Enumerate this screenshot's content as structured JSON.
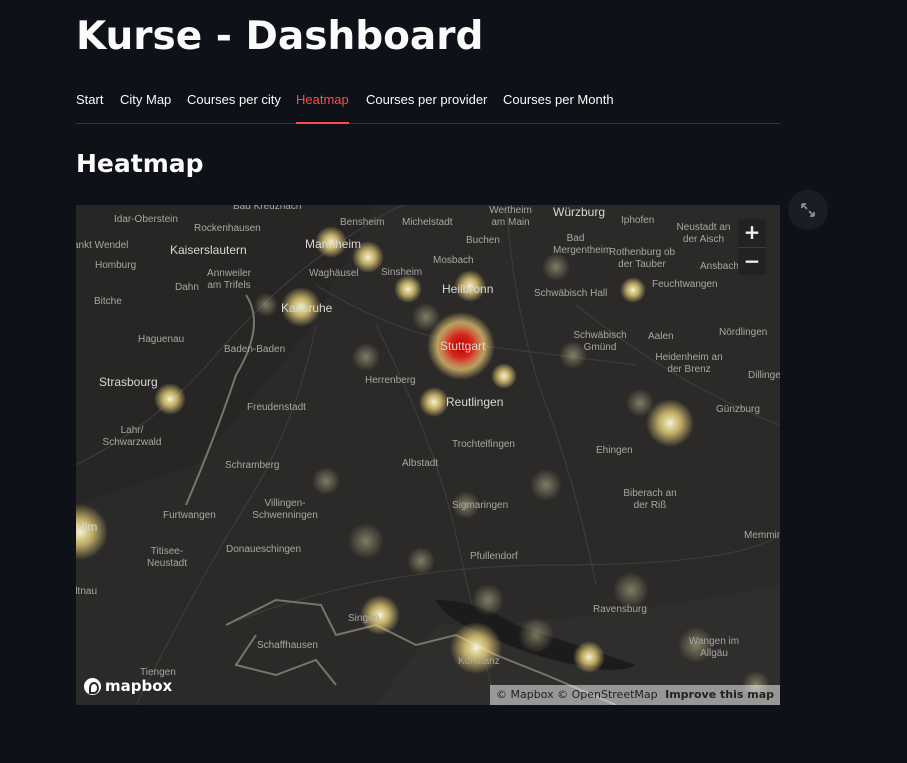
{
  "page": {
    "title": "Kurse - Dashboard"
  },
  "tabs": [
    {
      "label": "Start"
    },
    {
      "label": "City Map"
    },
    {
      "label": "Courses per city"
    },
    {
      "label": "Heatmap",
      "active": true
    },
    {
      "label": "Courses per provider"
    },
    {
      "label": "Courses per Month"
    }
  ],
  "section": {
    "title": "Heatmap"
  },
  "map": {
    "zoom_in": "+",
    "zoom_out": "−",
    "logo": "mapbox",
    "attribution": "© Mapbox © OpenStreetMap",
    "improve": "Improve this map",
    "labels": [
      "Bad Kreuznach",
      "Idar-Oberstein",
      "Rockenhausen",
      "Bensheim",
      "Michelstadt",
      "Wertheim am Main",
      "Würzburg",
      "Iphofen",
      "Neustadt an der Aisch",
      "ankt Wendel",
      "Kaiserslautern",
      "Buchen",
      "Bad Mergentheim",
      "Rothenburg ob der Tauber",
      "Homburg",
      "Annweiler am Trifels",
      "Dahn",
      "Waghäusel",
      "Sinsheim",
      "Mosbach",
      "Ansbach",
      "Feuchtwangen",
      "Heilbronn",
      "Schwäbisch Hall",
      "Bitche",
      "Karlsruhe",
      "Mannheim",
      "Haguenau",
      "Baden-Baden",
      "Schwäbisch Gmünd",
      "Aalen",
      "Nördlingen",
      "Heidenheim an der Brenz",
      "Stuttgart",
      "Strasbourg",
      "Herrenberg",
      "Dillingen",
      "Freudenstadt",
      "Reutlingen",
      "Günzburg",
      "Lahr/ Schwarzwald",
      "Trochtelfingen",
      "Ehingen",
      "Schramberg",
      "Albstadt",
      "Biberach an der Riß",
      "Furtwangen",
      "Villingen- Schwenningen",
      "Sigmaringen",
      "Memmingen",
      "Titisee- Neustadt",
      "Donaueschingen",
      "Pfullendorf",
      "Ulm",
      "dtnau",
      "Ravensburg",
      "Singen",
      "Schaffhausen",
      "Konstanz",
      "Wangen im Allgäu",
      "Tiengen"
    ]
  },
  "icons": {
    "fullscreen": "expand-icon"
  },
  "colors": {
    "accent": "#ff4b4b",
    "background": "#0e1117"
  }
}
